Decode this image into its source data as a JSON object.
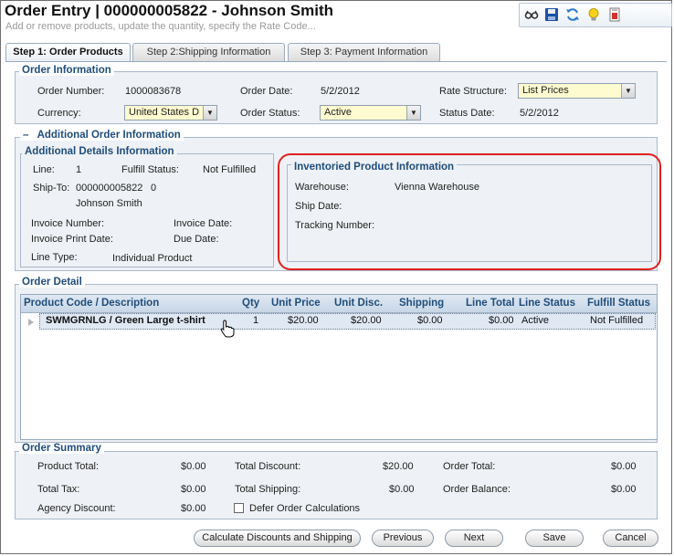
{
  "header": {
    "title": "Order Entry | 000000005822 - Johnson Smith",
    "subtitle": "Add or remove products, update the quantity, specify the Rate Code..."
  },
  "toolbar": {
    "icons": [
      "glasses-icon",
      "save-icon",
      "refresh-icon",
      "lightbulb-icon",
      "report-icon"
    ]
  },
  "tabs": [
    {
      "label": "Step 1: Order Products",
      "active": true
    },
    {
      "label": "Step 2:Shipping Information",
      "active": false
    },
    {
      "label": "Step 3: Payment Information",
      "active": false
    }
  ],
  "order_info": {
    "title": "Order Information",
    "order_number_label": "Order Number:",
    "order_number": "1000083678",
    "order_date_label": "Order Date:",
    "order_date": "5/2/2012",
    "rate_structure_label": "Rate Structure:",
    "rate_structure": "List Prices",
    "currency_label": "Currency:",
    "currency": "United States D",
    "order_status_label": "Order Status:",
    "order_status": "Active",
    "status_date_label": "Status Date:",
    "status_date": "5/2/2012"
  },
  "additional": {
    "collapse_symbol": "–",
    "title": "Additional Order Information",
    "details_title": "Additional Details Information",
    "line_label": "Line:",
    "line": "1",
    "fulfill_status_label": "Fulfill Status:",
    "fulfill_status": "Not Fulfilled",
    "ship_to_label": "Ship-To:",
    "ship_to_id": "000000005822",
    "ship_to_num": "0",
    "ship_to_name": "Johnson Smith",
    "invoice_number_label": "Invoice Number:",
    "invoice_date_label": "Invoice Date:",
    "invoice_print_date_label": "Invoice Print Date:",
    "due_date_label": "Due Date:",
    "line_type_label": "Line Type:",
    "line_type": "Individual Product"
  },
  "inventoried": {
    "title": "Inventoried Product Information",
    "warehouse_label": "Warehouse:",
    "warehouse": "Vienna Warehouse",
    "ship_date_label": "Ship Date:",
    "tracking_label": "Tracking Number:"
  },
  "order_detail": {
    "title": "Order Detail",
    "columns": [
      "Product Code / Description",
      "Qty",
      "Unit Price",
      "Unit Disc.",
      "Shipping",
      "Line Total",
      "Line Status",
      "Fulfill Status"
    ],
    "rows": [
      {
        "product": "SWMGRNLG / Green Large t-shirt",
        "qty": "1",
        "unit_price": "$20.00",
        "unit_disc": "$20.00",
        "shipping": "$0.00",
        "line_total": "$0.00",
        "line_status": "Active",
        "fulfill_status": "Not Fulfilled"
      }
    ]
  },
  "summary": {
    "title": "Order Summary",
    "product_total_label": "Product Total:",
    "product_total": "$0.00",
    "total_discount_label": "Total Discount:",
    "total_discount": "$20.00",
    "order_total_label": "Order Total:",
    "order_total": "$0.00",
    "total_tax_label": "Total Tax:",
    "total_tax": "$0.00",
    "total_shipping_label": "Total Shipping:",
    "total_shipping": "$0.00",
    "order_balance_label": "Order Balance:",
    "order_balance": "$0.00",
    "agency_discount_label": "Agency Discount:",
    "agency_discount": "$0.00",
    "defer_label": "Defer Order Calculations"
  },
  "buttons": {
    "calculate": "Calculate Discounts and Shipping",
    "previous": "Previous",
    "next": "Next",
    "save": "Save",
    "cancel": "Cancel"
  },
  "colors": {
    "accent": "#1f4d7a",
    "highlight_field": "#fffbd0",
    "callout": "#e02020"
  }
}
